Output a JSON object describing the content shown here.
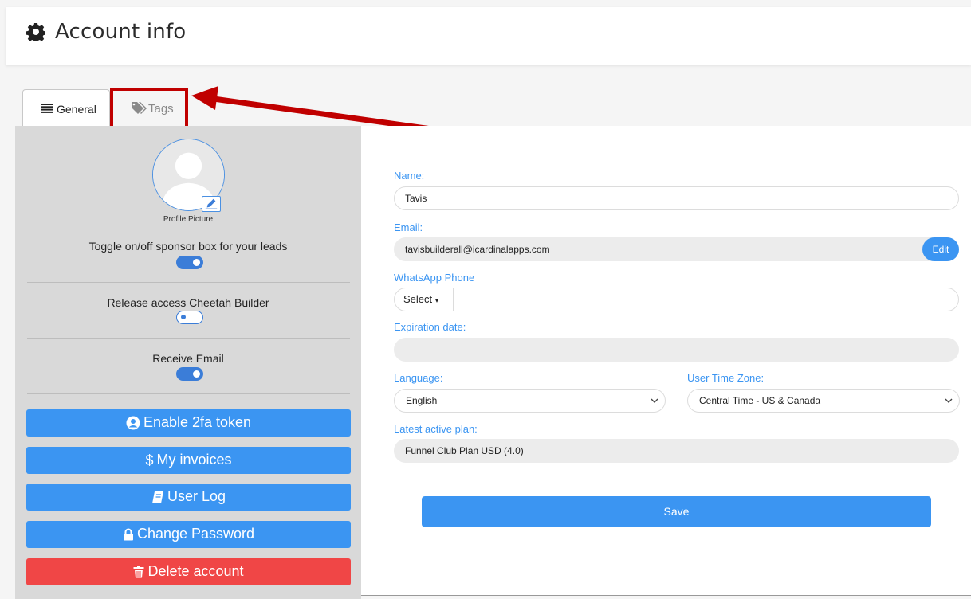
{
  "header": {
    "title": "Account info",
    "icon": "gear-icon"
  },
  "tabs": [
    {
      "label": "General",
      "icon": "list-icon",
      "active": true
    },
    {
      "label": "Tags",
      "icon": "tags-icon",
      "active": false
    }
  ],
  "annotation": {
    "highlight_color": "#c00000"
  },
  "sidebar": {
    "profile_picture_label": "Profile Picture",
    "toggles": [
      {
        "label": "Toggle on/off sponsor box for your leads",
        "state": "on"
      },
      {
        "label": "Release access Cheetah Builder",
        "state": "off"
      },
      {
        "label": "Receive Email",
        "state": "on"
      }
    ],
    "buttons": [
      {
        "label": "Enable 2fa token",
        "icon": "user-circle-icon"
      },
      {
        "label": "My invoices",
        "icon": "dollar-icon"
      },
      {
        "label": "User Log",
        "icon": "book-icon"
      },
      {
        "label": "Change Password",
        "icon": "lock-icon"
      },
      {
        "label": "Delete account",
        "icon": "trash-icon"
      }
    ]
  },
  "form": {
    "name_label": "Name:",
    "name_value": "Tavis",
    "email_label": "Email:",
    "email_value": "tavisbuilderall@icardinalapps.com",
    "email_edit": "Edit",
    "whatsapp_label": "WhatsApp Phone",
    "whatsapp_select": "Select",
    "whatsapp_value": "",
    "expiration_label": "Expiration date:",
    "expiration_value": "",
    "language_label": "Language:",
    "language_value": "English",
    "timezone_label": "User Time Zone:",
    "timezone_value": "Central Time - US & Canada",
    "plan_label": "Latest active plan:",
    "plan_value": "Funnel Club Plan USD (4.0)",
    "save_label": "Save"
  },
  "colors": {
    "accent": "#3b95f2",
    "danger": "#f04646",
    "toggle": "#3b7dd8"
  }
}
